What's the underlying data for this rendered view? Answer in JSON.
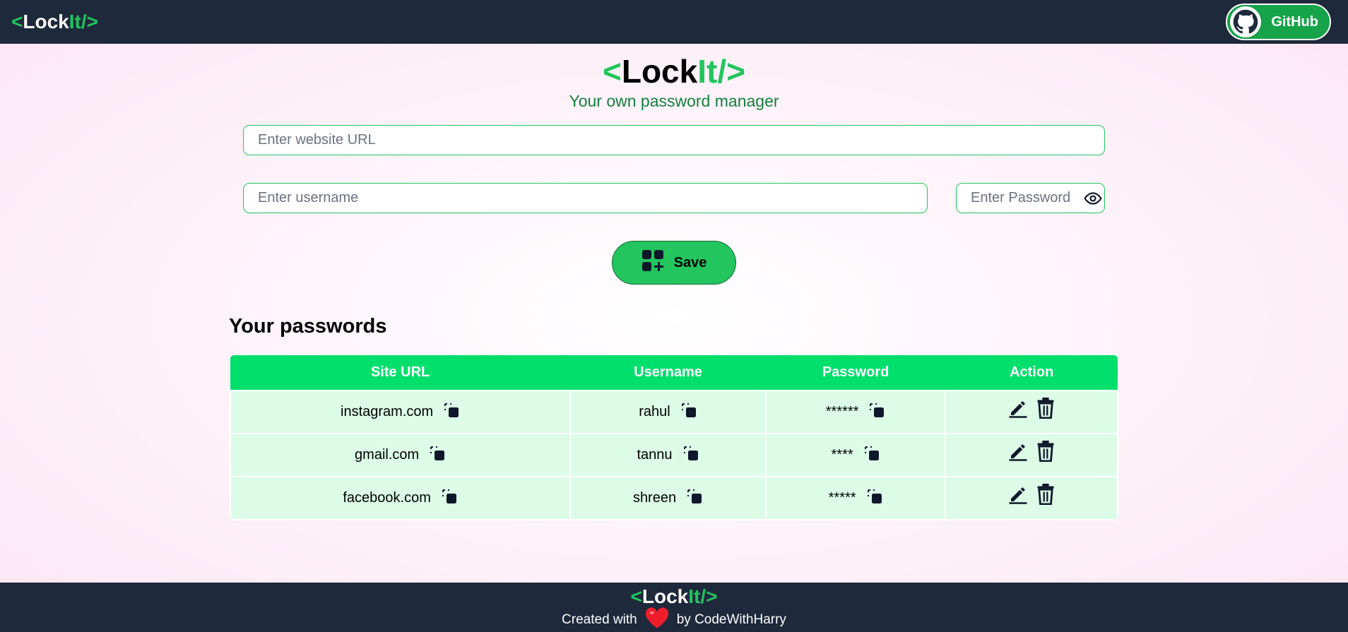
{
  "navbar": {
    "logo": {
      "open": "<",
      "lock": "Lock",
      "it": "It",
      "close": " />"
    },
    "github_label": "GitHub"
  },
  "hero": {
    "logo": {
      "open": "<",
      "lock": "Lock",
      "it": "It",
      "close": " />"
    },
    "tagline": "Your own password manager"
  },
  "form": {
    "site_placeholder": "Enter website URL",
    "username_placeholder": "Enter username",
    "password_placeholder": "Enter Password",
    "save_label": "Save"
  },
  "passwords": {
    "title": "Your passwords",
    "columns": [
      "Site URL",
      "Username",
      "Password",
      "Action"
    ],
    "rows": [
      {
        "site": "instagram.com",
        "username": "rahul",
        "password": "******"
      },
      {
        "site": "gmail.com",
        "username": "tannu",
        "password": "****"
      },
      {
        "site": "facebook.com",
        "username": "shreen",
        "password": "*****"
      }
    ]
  },
  "footer": {
    "logo": {
      "open": "<",
      "lock": "Lock",
      "it": "It",
      "close": " />"
    },
    "created_with": "Created with",
    "by": "by CodeWithHarry"
  },
  "colors": {
    "navbar_bg": "#1e293b",
    "accent_green": "#22c55e",
    "table_header": "#00df6c",
    "table_row": "#dcfce7"
  },
  "icons": [
    "github-icon",
    "eye-icon",
    "add-grid-icon",
    "copy-icon",
    "edit-icon",
    "delete-icon",
    "heart-icon"
  ]
}
